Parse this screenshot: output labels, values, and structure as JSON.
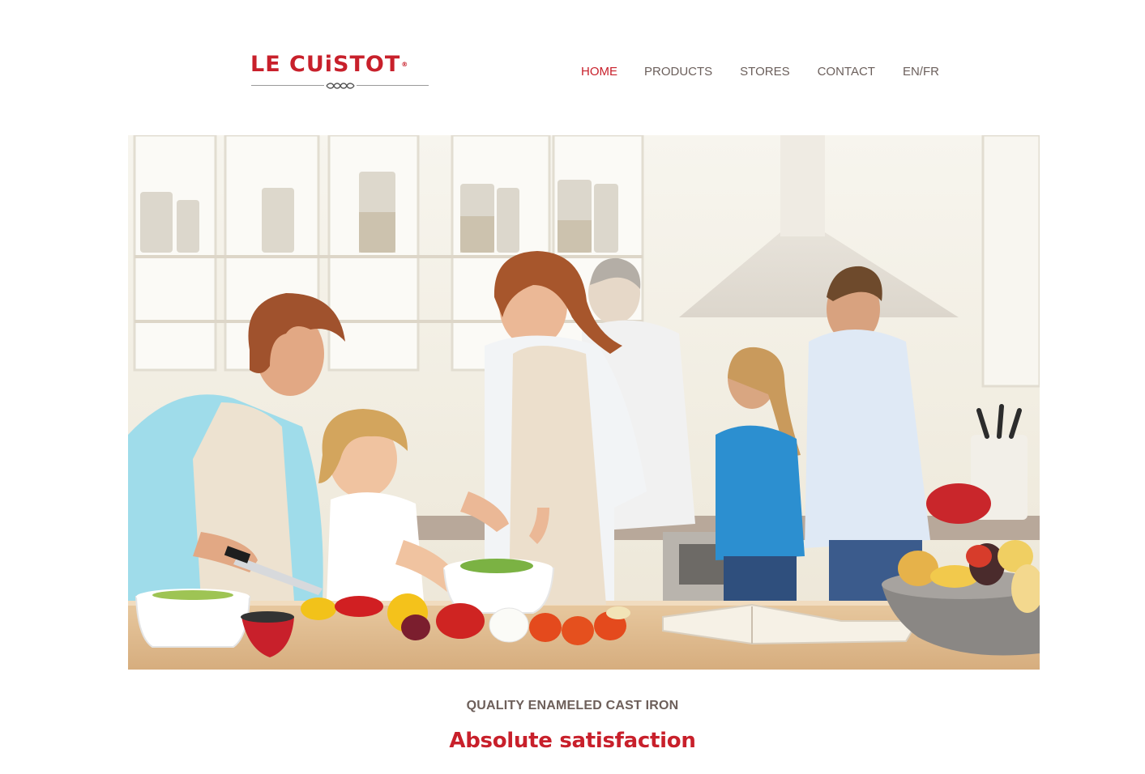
{
  "brand": {
    "name": "LE CUiSTOT",
    "registered_mark": "®",
    "color": "#c8202b"
  },
  "nav": {
    "items": [
      {
        "label": "HOME",
        "active": true
      },
      {
        "label": "PRODUCTS",
        "active": false
      },
      {
        "label": "STORES",
        "active": false
      },
      {
        "label": "CONTACT",
        "active": false
      },
      {
        "label": "EN/FR",
        "active": false
      }
    ],
    "active_color": "#c8202b",
    "color": "#6b5f5b"
  },
  "hero": {
    "icon": "family-cooking-photo"
  },
  "content": {
    "tagline": "QUALITY ENAMELED CAST IRON",
    "headline": "Absolute satisfaction"
  }
}
